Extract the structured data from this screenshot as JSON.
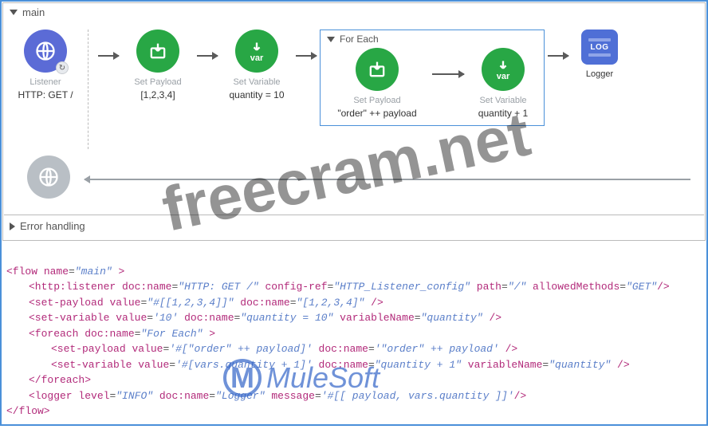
{
  "flow": {
    "name": "main",
    "listener": {
      "label": "Listener",
      "sub": "HTTP: GET /"
    },
    "setPayload": {
      "label": "Set Payload",
      "sub": "[1,2,3,4]"
    },
    "setVariable": {
      "label": "Set Variable",
      "sub": "quantity = 10"
    },
    "foreach": {
      "title": "For Each",
      "setPayload": {
        "label": "Set Payload",
        "sub": "\"order\" ++ payload"
      },
      "setVariable": {
        "label": "Set Variable",
        "sub": "quantity + 1"
      }
    },
    "logger": {
      "label": "Logger",
      "badge": "LOG"
    },
    "errorHandling": "Error handling"
  },
  "code": {
    "l1_open": "<flow",
    "l1_a1": "name",
    "l1_v1": "\"main\"",
    "l1_close": " >",
    "l2_open": "<http:listener",
    "l2_a1": "doc:name",
    "l2_v1": "\"HTTP: GET /\"",
    "l2_a2": "config-ref",
    "l2_v2": "\"HTTP_Listener_config\"",
    "l2_a3": "path",
    "l2_v3": "\"/\"",
    "l2_a4": "allowedMethods",
    "l2_v4": "\"GET\"",
    "l2_end": "/>",
    "l3_open": "<set-payload",
    "l3_a1": "value",
    "l3_v1": "\"#[[1,2,3,4]]\"",
    "l3_a2": "doc:name",
    "l3_v2": "\"[1,2,3,4]\"",
    "l3_end": "/>",
    "l4_open": "<set-variable",
    "l4_a1": "value",
    "l4_v1": "'10'",
    "l4_a2": "doc:name",
    "l4_v2": "\"quantity = 10\"",
    "l4_a3": "variableName",
    "l4_v3": "\"quantity\"",
    "l4_end": "/>",
    "l5_open": "<foreach",
    "l5_a1": "doc:name",
    "l5_v1": "\"For Each\"",
    "l5_close": " >",
    "l6_open": "<set-payload",
    "l6_a1": "value",
    "l6_v1": "'#[\"order\" ++ payload]'",
    "l6_a2": "doc:name",
    "l6_v2": "'\"order\" ++ payload'",
    "l6_end": "/>",
    "l7_open": "<set-variable",
    "l7_a1": "value",
    "l7_v1": "'#[vars.quantity + 1]'",
    "l7_a2": "doc:name",
    "l7_v2": "\"quantity + 1\"",
    "l7_a3": "variableName",
    "l7_v3": "\"quantity\"",
    "l7_end": "/>",
    "l8": "</foreach>",
    "l9_open": "<logger",
    "l9_a1": "level",
    "l9_v1": "\"INFO\"",
    "l9_a2": "doc:name",
    "l9_v2": "\"Logger\"",
    "l9_a3": "message",
    "l9_v3": "'#[[ payload, vars.quantity ]]'",
    "l9_end": "/>",
    "l10": "</flow>"
  },
  "watermarks": {
    "w1": "freecram.net",
    "w2_logo": "M",
    "w2_text": "MuleSoft"
  }
}
